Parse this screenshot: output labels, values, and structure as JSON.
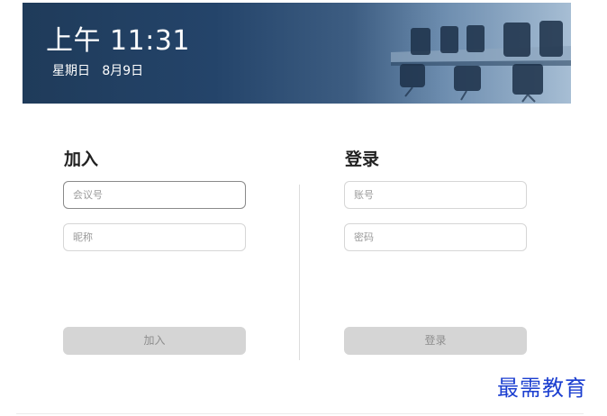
{
  "banner": {
    "time": "上午  11:31",
    "date": "星期日   8月9日"
  },
  "join": {
    "title": "加入",
    "meeting_id_placeholder": "会议号",
    "nickname_placeholder": "昵称",
    "button_label": "加入"
  },
  "login": {
    "title": "登录",
    "account_placeholder": "账号",
    "password_placeholder": "密码",
    "button_label": "登录"
  },
  "watermark": "最需教育",
  "colors": {
    "banner_dark": "#1f3b5a",
    "button_disabled_bg": "#d5d5d5",
    "button_disabled_text": "#8e8e8e",
    "watermark": "#1c3fd0"
  }
}
